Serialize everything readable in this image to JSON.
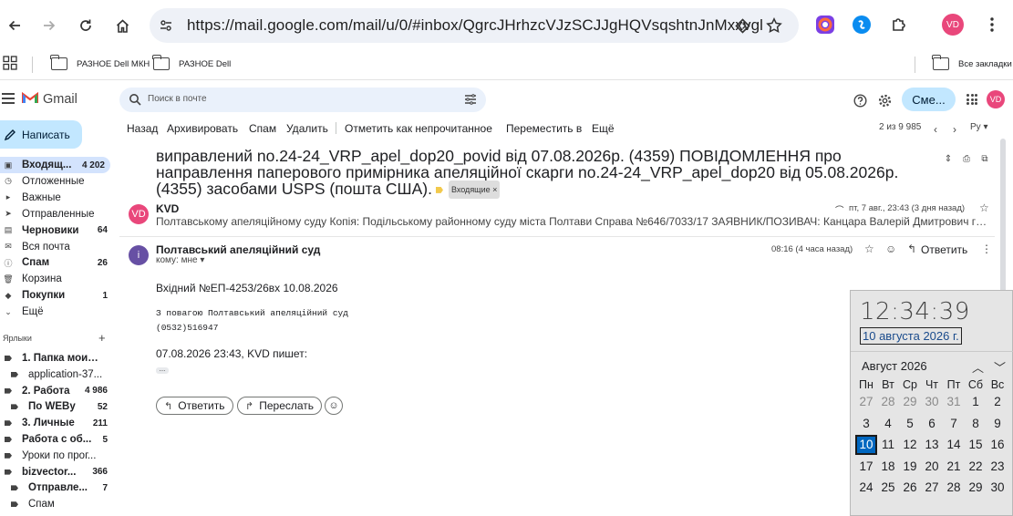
{
  "browser": {
    "url": "https://mail.google.com/mail/u/0/#inbox/QgrcJHrhzcVJzSCJJgHQVsqshtnJnMxxvgl",
    "avatar": "VD",
    "bookmarks": [
      "РАЗНОЕ Dell МКН",
      "РАЗНОЕ Dell"
    ],
    "all_bookmarks": "Все закладки"
  },
  "gmail": {
    "brand": "Gmail",
    "search_placeholder": "Поиск в почте",
    "smart_button": "Сме...",
    "avatar": "VD"
  },
  "sidebar": {
    "compose": "Написать",
    "items": [
      {
        "label": "Входящ...",
        "count": "4 202",
        "icon": "inbox-icon"
      },
      {
        "label": "Отложенные",
        "count": "",
        "icon": "clock-icon"
      },
      {
        "label": "Важные",
        "count": "",
        "icon": "important-icon"
      },
      {
        "label": "Отправленные",
        "count": "",
        "icon": "send-icon"
      },
      {
        "label": "Черновики",
        "count": "64",
        "icon": "draft-icon"
      },
      {
        "label": "Вся почта",
        "count": "",
        "icon": "mail-icon"
      },
      {
        "label": "Спам",
        "count": "26",
        "icon": "spam-icon"
      },
      {
        "label": "Корзина",
        "count": "",
        "icon": "trash-icon"
      },
      {
        "label": "Покупки",
        "count": "1",
        "icon": "tag-icon"
      },
      {
        "label": "Ещё",
        "count": "",
        "icon": "chevron-down-icon"
      }
    ],
    "labels_title": "Ярлыки",
    "labels": [
      {
        "label": "1. Папка моих з...",
        "count": ""
      },
      {
        "label": "application-37...",
        "count": ""
      },
      {
        "label": "2. Работа",
        "count": "4 986"
      },
      {
        "label": "По WEBу",
        "count": "52"
      },
      {
        "label": "3. Личные",
        "count": "211"
      },
      {
        "label": "Работа с об...",
        "count": "5"
      },
      {
        "label": "Уроки по прог...",
        "count": ""
      },
      {
        "label": "bizvector...",
        "count": "366"
      },
      {
        "label": "Отправле...",
        "count": "7"
      },
      {
        "label": "Спам",
        "count": ""
      }
    ]
  },
  "toolbar": {
    "back": "Назад",
    "archive": "Архивировать",
    "spam": "Спам",
    "delete": "Удалить",
    "mark_unread": "Отметить как непрочитанное",
    "move": "Переместить в",
    "more": "Ещё",
    "pager": "2 из 9 985",
    "lang": "Ру"
  },
  "email": {
    "subject": "виправлений no.24-24_VRP_apel_dop20_povid від 07.08.2026р. (4359) ПОВІДОМЛЕННЯ про направлення паперового примірника апеляційної скарги no.24-24_VRP_apel_dop20 від 05.08.2026р. (4355) засобами USPS (пошта США).",
    "inbox_chip": "Входящие ×",
    "msg1": {
      "avatar": "VD",
      "sender": "KVD",
      "date": "пт, 7 авг., 23:43 (3 дня назад)",
      "snippet": "Полтавському апеляційному суду Копія: Подільському районному суду міста Полтави Справа №646/7033/17 ЗАЯВНИК/ПОЗИВАЧ: Канцара Валерій Дмитрович гр..."
    },
    "msg2": {
      "avatar": "i",
      "sender": "Полтавський апеляційний суд",
      "to": "кому: мне ▾",
      "date": "08:16 (4 часа назад)",
      "reply": "Ответить",
      "line1": "Вхідний №ЕП-4253/26вх   10.08.2026",
      "line2": "З повагою Полтавський апеляційний суд",
      "line3": "(0532)516947",
      "line4": "07.08.2026 23:43, KVD пишет:"
    },
    "reply_button": "Ответить",
    "forward_button": "Переслать"
  },
  "calendar": {
    "time": "12:34:39",
    "date": "10 августа 2026 г.",
    "month": "Август 2026",
    "weekdays": [
      "Пн",
      "Вт",
      "Ср",
      "Чт",
      "Пт",
      "Сб",
      "Вс"
    ],
    "weeks": [
      [
        "27",
        "28",
        "29",
        "30",
        "31",
        "1",
        "2"
      ],
      [
        "3",
        "4",
        "5",
        "6",
        "7",
        "8",
        "9"
      ],
      [
        "10",
        "11",
        "12",
        "13",
        "14",
        "15",
        "16"
      ],
      [
        "17",
        "18",
        "19",
        "20",
        "21",
        "22",
        "23"
      ],
      [
        "24",
        "25",
        "26",
        "27",
        "28",
        "29",
        "30"
      ]
    ],
    "today": "10",
    "colors": {
      "today_bg": "#0067c0",
      "link": "#1a4b8c"
    }
  },
  "colors": {
    "compose_bg": "#c2e7ff",
    "active_bg": "#d3e3fd",
    "avatar": "#e9477b",
    "court_avatar": "#6750a4"
  }
}
